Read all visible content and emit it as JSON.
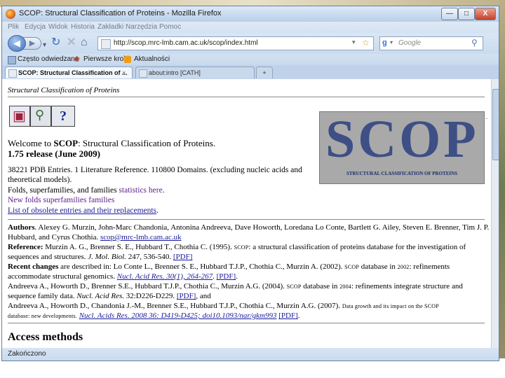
{
  "window": {
    "title": "SCOP: Structural Classification of Proteins - Mozilla Firefox",
    "min": "—",
    "max": "□",
    "close": "X"
  },
  "menu": [
    "Plik",
    "Edycja",
    "Widok",
    "Historia",
    "Zakładki",
    "Narzędzia",
    "Pomoc"
  ],
  "nav": {
    "url": "http://scop.mrc-lmb.cam.ac.uk/scop/index.html",
    "search_placeholder": "Google"
  },
  "bookmarks": [
    "Często odwiedzane",
    "Pierwsze kroki",
    "Aktualności"
  ],
  "tabs": [
    {
      "label": "SCOP: Structural Classification of ...",
      "close": "×"
    },
    {
      "label": "about:intro [CATH]"
    }
  ],
  "new_tab": "+",
  "page": {
    "header": "Structural Classification of Proteins",
    "help_icon": "?",
    "logo_text": "SCOP",
    "logo_caption": "STRUCTURAL CLASSIFICATION OF PROTEINS",
    "welcome_prefix": "Welcome to ",
    "welcome_bold": "SCOP",
    "welcome_suffix": ": Structural Classification of Proteins.",
    "release": "1.75 release (June 2009)",
    "stats_line1": "38221 PDB Entries. 1 Literature Reference. 110800 Domains. (excluding nucleic acids and",
    "stats_line2": "theoretical models).",
    "folds_prefix": "Folds, superfamilies, and families ",
    "folds_link": "statistics here",
    "folds_suffix": ".",
    "new_folds_link": "New folds superfamilies families",
    "obsolete_link": "List of obsolete entries and their replacements",
    "obsolete_suffix": ".",
    "authors_label": "Authors",
    "authors_line1": ". Alexey G. Murzin, John-Marc Chandonia, Antonina Andreeva, Dave Howorth, Loredana Lo Conte, Bartlett G. Ailey, Steven E. Brenner, Tim J. P.",
    "authors_line2": "Hubbard, and Cyrus Chothia. ",
    "authors_email": "scop@mrc-lmb.cam.ac.uk",
    "reference_label": "Reference:",
    "reference_line1_a": " Murzin A. G., Brenner S. E., Hubbard T., Chothia C. (1995). ",
    "reference_scop": "SCOP",
    "reference_line1_b": ": a structural classification of proteins database for the investigation of",
    "reference_line2_a": "sequences and structures. ",
    "reference_journal": "J. Mol. Biol.",
    "reference_line2_b": " 247, 536-540. ",
    "pdf": "[PDF]",
    "recent_label": "Recent changes",
    "recent_line1_a": " are described in: Lo Conte L., Brenner S. E., Hubbard T.J.P., Chothia C., Murzin A. (2002). ",
    "recent_scop": "SCOP",
    "recent_line1_b": " database in ",
    "recent_year": "2002",
    "recent_line1_c": ": refinements",
    "recent_line2_a": "accommodate structural genomics. ",
    "recent_link": "Nucl. Acid Res. 30(1), 264-267",
    "recent_line2_b": ". ",
    "recent_line2_c": ".",
    "andreeva1_line1_a": "Andreeva A., Howorth D., Brenner S.E., Hubbard T.J.P., Chothia C., Murzin A.G. (2004). ",
    "andreeva1_scop": "SCOP",
    "andreeva1_line1_b": " database in ",
    "andreeva1_year": "2004",
    "andreeva1_line1_c": ": refinements integrate structure and",
    "andreeva1_line2_a": "sequence family data. ",
    "andreeva1_journal": "Nucl. Acid Res.",
    "andreeva1_line2_b": " 32:D226-D229. ",
    "andreeva1_line2_c": ", and",
    "andreeva2_line1_a": "Andreeva A., Howorth D., Chandonia J.-M., Brenner S.E., Hubbard T.J.P., Chothia C., Murzin A.G. (2007). ",
    "andreeva2_small": "Data growth and its impact on the SCOP",
    "andreeva2_line2_small": "database: new developments.",
    "andreeva2_link": "Nucl. Acids Res. 2008 36: D419-D425; doi10.1093/nar/gkm993",
    "andreeva2_line2_b": " ",
    "andreeva2_line2_c": ".",
    "access_heading": "Access methods"
  },
  "status": "Zakończono"
}
